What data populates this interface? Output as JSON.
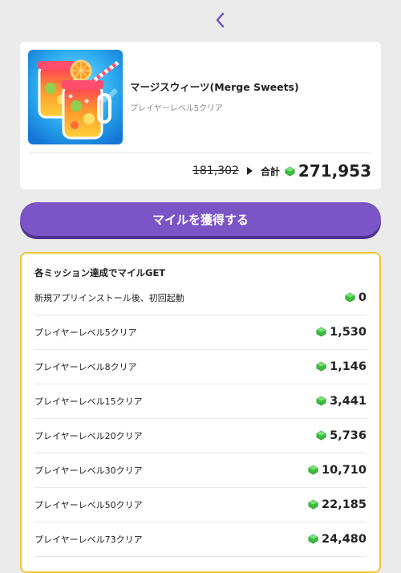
{
  "header": {
    "back_icon": "chevron-left-icon",
    "accent": "#6c4ec2"
  },
  "app": {
    "title": "マージスウィーツ(Merge Sweets)",
    "subtitle": "プレイヤーレベル5クリア",
    "original_price": "181,302",
    "total_label": "合計",
    "total_value": "271,953"
  },
  "cta": {
    "label": "マイルを獲得する",
    "color": "#7b55c5"
  },
  "missions": {
    "heading": "各ミッション達成でマイルGET",
    "border_color": "#f3c431",
    "items": [
      {
        "label": "新規アプリインストール後、初回起動",
        "value": "0"
      },
      {
        "label": "プレイヤーレベル5クリア",
        "value": "1,530"
      },
      {
        "label": "プレイヤーレベル8クリア",
        "value": "1,146"
      },
      {
        "label": "プレイヤーレベル15クリア",
        "value": "3,441"
      },
      {
        "label": "プレイヤーレベル20クリア",
        "value": "5,736"
      },
      {
        "label": "プレイヤーレベル30クリア",
        "value": "10,710"
      },
      {
        "label": "プレイヤーレベル50クリア",
        "value": "22,185"
      },
      {
        "label": "プレイヤーレベル73クリア",
        "value": "24,480"
      }
    ]
  }
}
